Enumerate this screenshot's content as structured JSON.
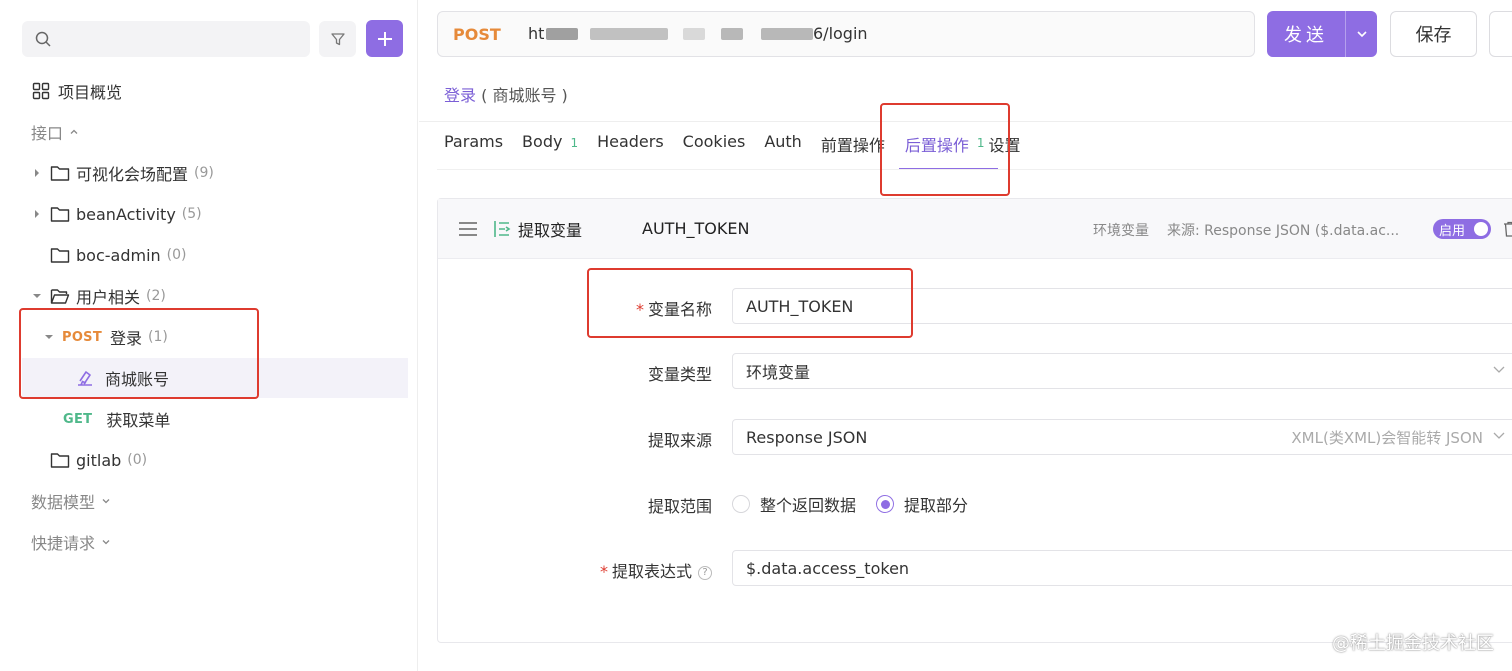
{
  "sidebar": {
    "search": {
      "placeholder": "",
      "value": ""
    },
    "overview_label": "项目概览",
    "section_api": "接口",
    "section_models": "数据模型",
    "section_quick": "快捷请求",
    "tree": [
      {
        "label": "可视化会场配置",
        "count": "(9)"
      },
      {
        "label": "beanActivity",
        "count": "(5)"
      },
      {
        "label": "boc-admin",
        "count": "(0)"
      },
      {
        "label": "用户相关",
        "count": "(2)"
      },
      {
        "method": "POST",
        "label": "登录",
        "count": "(1)"
      },
      {
        "label": "商城账号"
      },
      {
        "method": "GET",
        "label": "获取菜单"
      },
      {
        "label": "gitlab",
        "count": "(0)"
      }
    ]
  },
  "request": {
    "method": "POST",
    "url_prefix": "ht",
    "url_suffix": "6/login",
    "send_label": "发送",
    "save_label": "保存"
  },
  "breadcrumb": {
    "link": "登录",
    "rest": "( 商城账号 )"
  },
  "tabs": [
    {
      "label": "Params"
    },
    {
      "label": "Body",
      "badge": "1"
    },
    {
      "label": "Headers"
    },
    {
      "label": "Cookies"
    },
    {
      "label": "Auth"
    },
    {
      "label": "前置操作"
    },
    {
      "label": "后置操作",
      "badge": "1"
    },
    {
      "label": "设置"
    }
  ],
  "extractor": {
    "title": "提取变量",
    "var_name": "AUTH_TOKEN",
    "scope_text": "环境变量",
    "source_text": "来源: Response JSON ($.data.ac...",
    "toggle_label": "启用",
    "form": {
      "name_label": "变量名称",
      "name_value": "AUTH_TOKEN",
      "type_label": "变量类型",
      "type_value": "环境变量",
      "source_label": "提取来源",
      "source_value": "Response JSON",
      "source_hint": "XML(类XML)会智能转 JSON",
      "range_label": "提取范围",
      "range_options": [
        "整个返回数据",
        "提取部分"
      ],
      "expr_label": "提取表达式",
      "expr_value": "$.data.access_token",
      "help_glyph": "?"
    }
  },
  "watermark": "@稀土掘金技术社区",
  "colors": {
    "accent": "#8e6de3",
    "post": "#e68a3a",
    "get": "#4fb88a",
    "annotation": "#de3b2f"
  }
}
